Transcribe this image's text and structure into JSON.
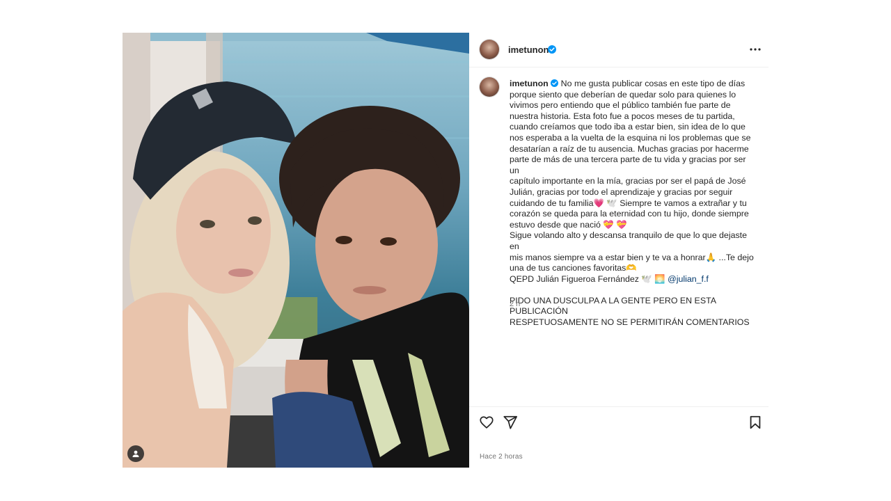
{
  "post": {
    "username": "imetunon",
    "caption_lines": [
      "No me gusta publicar cosas en este tipo de días",
      "porque siento que deberían de quedar solo para quienes lo",
      "vivimos pero entiendo que el público también fue parte de",
      "nuestra historia. Esta foto fue a pocos meses de tu partida,",
      "cuando creíamos que todo iba a estar bien, sin idea de lo que",
      "nos esperaba a la vuelta de la esquina ni los problemas que se",
      "desatarían a raíz de tu ausencia. Muchas gracias por hacerme",
      "parte de más de una tercera parte de tu vida y gracias por ser un",
      "capítulo importante en la mía, gracias por ser el papá de José",
      "Julián, gracias por todo el aprendizaje y gracias por seguir",
      "cuidando de tu familia💗 🕊️  Siempre te vamos a extrañar y tu",
      "corazón se queda para la eternidad con tu hijo, donde siempre",
      "estuvo desde que nació 💝 💝",
      "Sigue volando alto y descansa tranquilo de que lo que dejaste en",
      "mis manos siempre va a estar bien y te va a honrar🙏 ...Te dejo",
      "una de tus canciones favoritas🫶",
      "QEPD Julián Figueroa Fernández 🕊️ 🌅 "
    ],
    "mention": "@julian_f.f",
    "notice_lines": [
      "PIDO UNA DUSCULPA A LA GENTE PERO EN ESTA PUBLICACIÓN",
      "RESPETUOSAMENTE NO SE PERMITIRÁN COMENTARIOS"
    ],
    "time_short": "2 h",
    "time_long": "Hace 2 horas"
  },
  "icons": {
    "more": "more-options-icon",
    "like": "heart-icon",
    "share": "send-icon",
    "save": "bookmark-icon",
    "tag": "user-tag-icon",
    "verified": "verified-badge-icon"
  },
  "colors": {
    "verified": "#0095f6",
    "mention": "#00376b",
    "muted": "#737373"
  }
}
